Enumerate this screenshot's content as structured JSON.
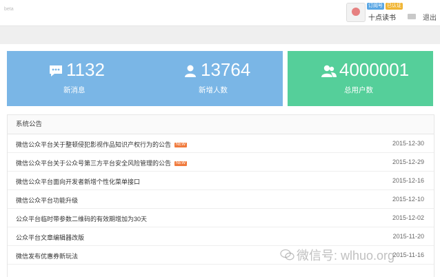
{
  "header": {
    "corner_tag": "beta",
    "badges": [
      "订阅号",
      "已认证"
    ],
    "account_name": "十点读书",
    "logout_label": "退出"
  },
  "stats": [
    {
      "value": "1132",
      "label": "新消息",
      "icon": "message-icon"
    },
    {
      "value": "13764",
      "label": "新增人数",
      "icon": "user-icon"
    },
    {
      "value": "4000001",
      "label": "总用户数",
      "icon": "users-icon"
    }
  ],
  "notices": {
    "title": "系统公告",
    "new_label": "NEW",
    "items": [
      {
        "title": "微信公众平台关于整顿侵犯影视作品知识产权行为的公告",
        "date": "2015-12-30",
        "is_new": true
      },
      {
        "title": "微信公众平台关于公众号第三方平台安全风险管理的公告",
        "date": "2015-12-29",
        "is_new": true
      },
      {
        "title": "微信公众平台面向开发者新增个性化菜单接口",
        "date": "2015-12-16",
        "is_new": false
      },
      {
        "title": "微信公众平台功能升级",
        "date": "2015-12-10",
        "is_new": false
      },
      {
        "title": "公众平台临时带参数二维码的有效期增加为30天",
        "date": "2015-12-02",
        "is_new": false
      },
      {
        "title": "公众平台文章编辑器改版",
        "date": "2015-11-20",
        "is_new": false
      },
      {
        "title": "微信发布优惠券新玩法",
        "date": "2015-11-16",
        "is_new": false
      }
    ]
  },
  "watermark": "微信号: wlhuo.org",
  "colors": {
    "stat_blue": "#7ab6e6",
    "stat_green": "#55cf9a",
    "new_badge": "#f07a3c"
  }
}
